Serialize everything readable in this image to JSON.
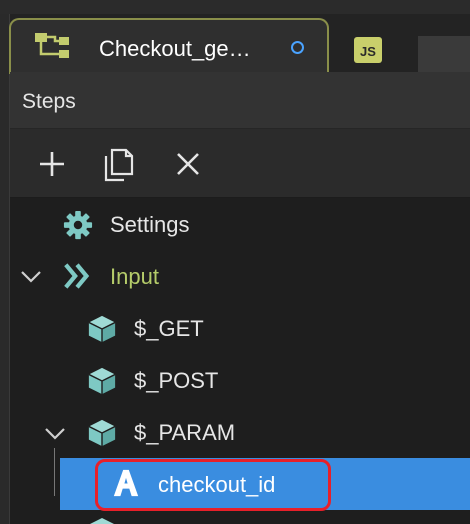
{
  "tabs": [
    {
      "label": "Checkout_ge…",
      "icon": "flow-icon",
      "active": true,
      "modified": true
    },
    {
      "label": "JS",
      "icon": "js-file-icon",
      "active": false
    }
  ],
  "panel": {
    "title": "Steps"
  },
  "toolbar": [
    {
      "name": "add-step-button",
      "icon": "plus-icon"
    },
    {
      "name": "duplicate-step-button",
      "icon": "copy-icon"
    },
    {
      "name": "delete-step-button",
      "icon": "close-icon"
    }
  ],
  "tree": {
    "settings": {
      "label": "Settings",
      "icon": "gear-icon"
    },
    "input": {
      "label": "Input",
      "icon": "double-chevron-icon",
      "expanded": true
    },
    "get": {
      "label": "$_GET",
      "icon": "cube-icon"
    },
    "post": {
      "label": "$_POST",
      "icon": "cube-icon"
    },
    "param": {
      "label": "$_PARAM",
      "icon": "cube-icon",
      "expanded": true
    },
    "checkout_id": {
      "label": "checkout_id",
      "icon": "string-type-icon",
      "selected": true
    }
  },
  "colors": {
    "accent_selected": "#3a8de0",
    "input_label": "#b5cc6a",
    "cube": "#7ec9c4",
    "highlight_border": "#e8202a"
  }
}
